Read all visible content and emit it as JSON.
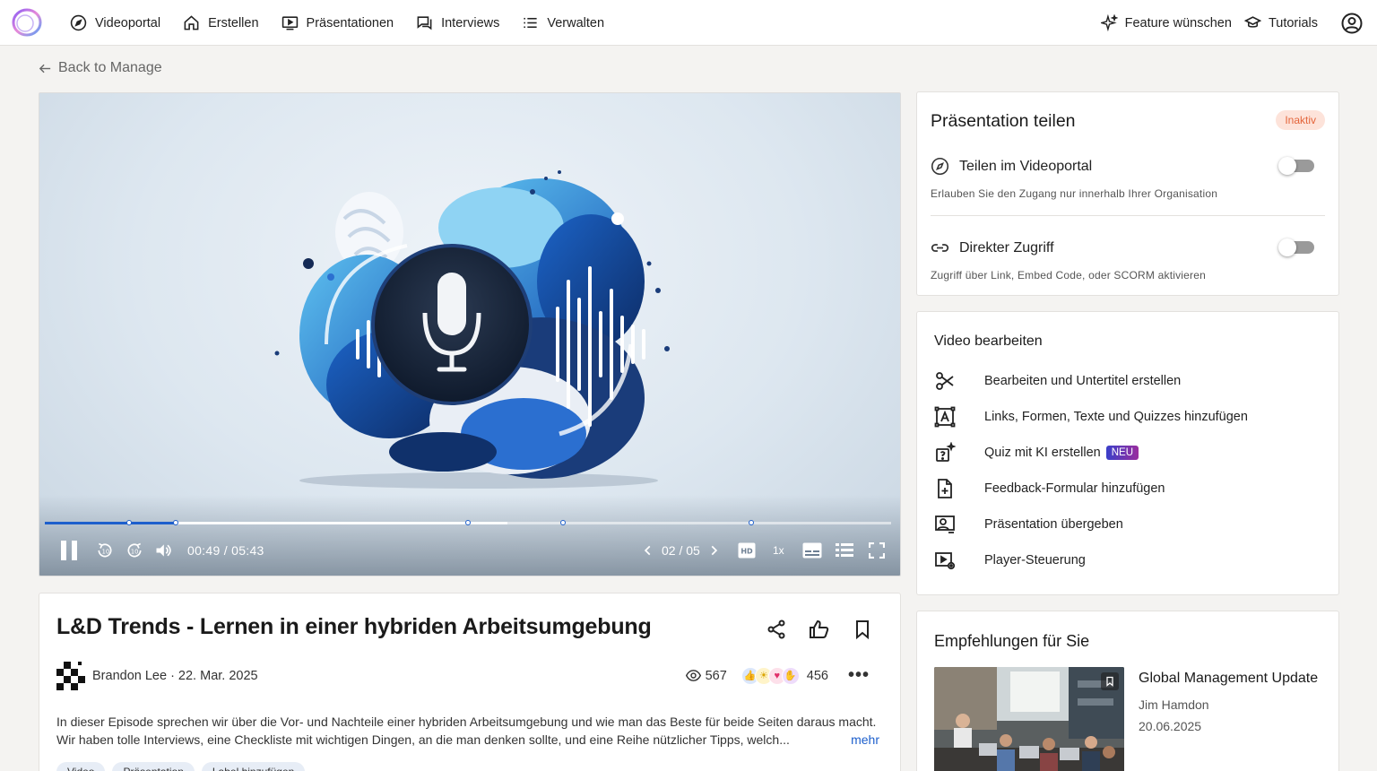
{
  "nav": {
    "items": [
      {
        "label": "Videoportal",
        "icon": "compass-icon"
      },
      {
        "label": "Erstellen",
        "icon": "home-icon"
      },
      {
        "label": "Präsentationen",
        "icon": "presentation-icon"
      },
      {
        "label": "Interviews",
        "icon": "chat-icon"
      },
      {
        "label": "Verwalten",
        "icon": "list-icon"
      }
    ],
    "feature_label": "Feature wünschen",
    "tutorials_label": "Tutorials"
  },
  "back_label": "Back to Manage",
  "player": {
    "current_time": "00:49",
    "duration": "05:43",
    "time_display": "00:49 / 05:43",
    "played_fraction": 0.155,
    "buffered_fraction": 0.547,
    "chapter_markers": [
      0.1,
      0.155,
      0.5,
      0.612,
      0.835
    ],
    "chapter_display": "02 / 05",
    "quality": "HD",
    "speed": "1x"
  },
  "video": {
    "title": "L&D Trends - Lernen in einer hybriden Arbeitsumgebung",
    "author": "Brandon Lee",
    "date": "22. Mar. 2025",
    "author_line": "Brandon Lee · 22. Mar. 2025",
    "views": "567",
    "reactions": "456",
    "description": "In dieser Episode sprechen wir über die Vor- und Nachteile einer hybriden Arbeitsumgebung und wie man das Beste für beide Seiten daraus macht. Wir haben tolle Interviews, eine Checkliste mit wichtigen Dingen, an die man denken sollte, und eine Reihe nützlicher Tipps, welch...",
    "more_label": "mehr",
    "tags": [
      "Video",
      "Präsentation",
      "Label hinzufügen"
    ]
  },
  "share": {
    "title": "Präsentation teilen",
    "status_badge": "Inaktiv",
    "portal_label": "Teilen im Videoportal",
    "portal_hint": "Erlauben Sie den Zugang nur innerhalb Ihrer Organisation",
    "direct_label": "Direkter Zugriff",
    "direct_hint": "Zugriff über Link, Embed Code, oder SCORM aktivieren"
  },
  "edit": {
    "title": "Video bearbeiten",
    "items": [
      {
        "label": "Bearbeiten und Untertitel erstellen",
        "icon": "scissors-icon"
      },
      {
        "label": "Links, Formen, Texte und Quizzes hinzufügen",
        "icon": "text-frame-icon"
      },
      {
        "label": "Quiz mit KI erstellen",
        "icon": "ai-quiz-icon",
        "badge": "NEU"
      },
      {
        "label": "Feedback-Formular hinzufügen",
        "icon": "file-plus-icon"
      },
      {
        "label": "Präsentation übergeben",
        "icon": "presenter-icon"
      },
      {
        "label": "Player-Steuerung",
        "icon": "player-settings-icon"
      }
    ]
  },
  "reco": {
    "title": "Empfehlungen für Sie",
    "item": {
      "title": "Global Management Update",
      "author": "Jim Hamdon",
      "date": "20.06.2025"
    }
  },
  "colors": {
    "accent": "#1d5fcc",
    "badge_bg": "#fde3da",
    "badge_text": "#e4643a"
  }
}
